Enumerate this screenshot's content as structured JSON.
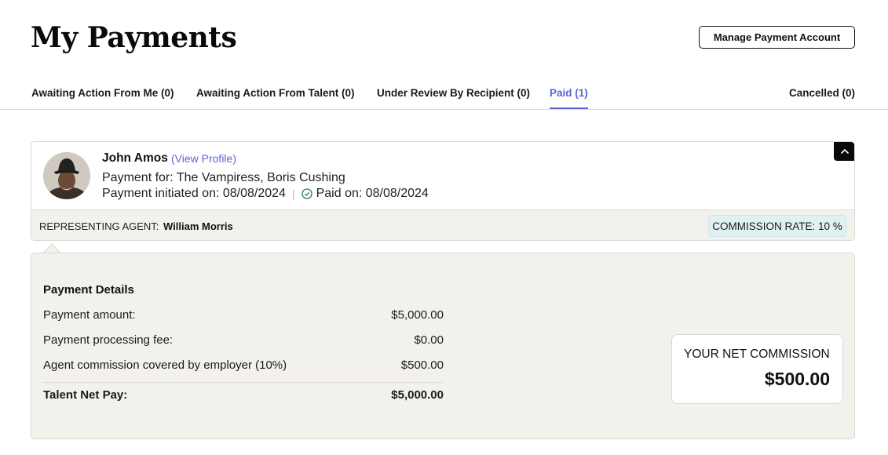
{
  "header": {
    "title": "My Payments",
    "manage_button": "Manage Payment Account"
  },
  "tabs": [
    {
      "label": "Awaiting Action From Me (0)",
      "active": false
    },
    {
      "label": "Awaiting Action From Talent (0)",
      "active": false
    },
    {
      "label": "Under Review By Recipient (0)",
      "active": false
    },
    {
      "label": "Paid (1)",
      "active": true
    },
    {
      "label": "Cancelled (0)",
      "active": false
    }
  ],
  "payment": {
    "talent_name": "John Amos",
    "view_profile": "(View Profile)",
    "payment_for": "Payment for: The Vampiress, Boris Cushing",
    "initiated": "Payment initiated on: 08/08/2024",
    "separator": "|",
    "paid_on": "Paid on: 08/08/2024",
    "agent_label": "REPRESENTING AGENT:",
    "agent_name": "William Morris",
    "commission_rate": "COMMISSION RATE: 10 %"
  },
  "details": {
    "title": "Payment Details",
    "rows": [
      {
        "label": "Payment amount:",
        "value": "$5,000.00"
      },
      {
        "label": "Payment processing fee:",
        "value": "$0.00"
      },
      {
        "label": "Agent commission covered by employer (10%)",
        "value": "$500.00"
      }
    ],
    "total": {
      "label": "Talent Net Pay:",
      "value": "$5,000.00"
    },
    "net_commission_label": "YOUR NET COMMISSION",
    "net_commission_value": "$500.00"
  },
  "colors": {
    "accent": "#5c63d6",
    "panel_bg": "#f3f1ec",
    "badge_bg": "#e0f1f3"
  }
}
